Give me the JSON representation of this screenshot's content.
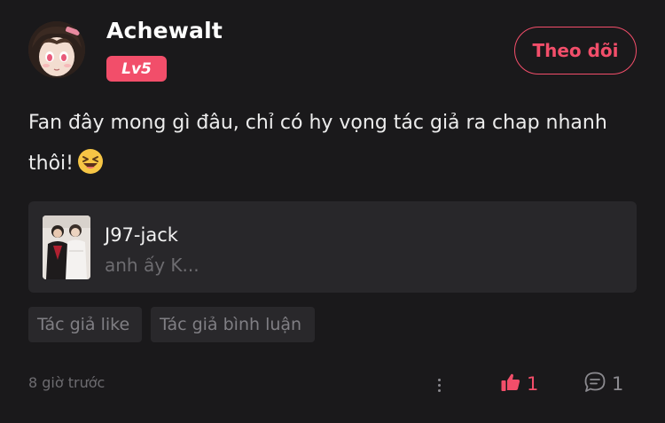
{
  "user": {
    "name": "Achewalt",
    "level": "Lv5",
    "follow_label": "Theo dõi"
  },
  "comment": {
    "text": "Fan đây mong gì đâu, chỉ có hy vọng tác giả ra chap nhanh thôi!",
    "emoji": "laughing-face-icon"
  },
  "quote": {
    "author": "J97-jack",
    "snippet": "anh ấy K..."
  },
  "tags": [
    "Tác giả like",
    "Tác giả bình luận"
  ],
  "footer": {
    "timestamp": "8 giờ trước",
    "likes": "1",
    "comments": "1"
  },
  "colors": {
    "background": "#1a191b",
    "accent": "#f24e6a",
    "card": "#28272a",
    "muted_text": "#6d6c70"
  }
}
